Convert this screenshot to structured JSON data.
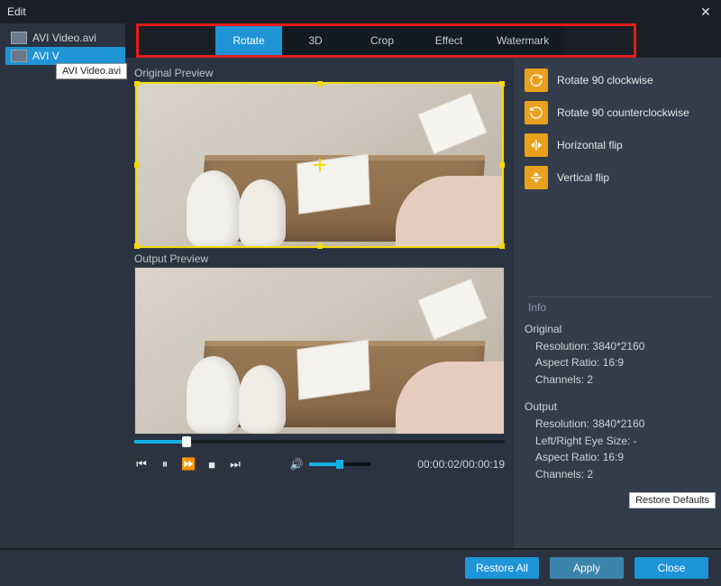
{
  "title": "Edit",
  "sidebar": {
    "items": [
      {
        "label": "AVI Video.avi"
      },
      {
        "label": "AVI V"
      }
    ],
    "tooltip": "AVI Video.avi"
  },
  "tabs": [
    {
      "label": "Rotate",
      "active": true
    },
    {
      "label": "3D"
    },
    {
      "label": "Crop"
    },
    {
      "label": "Effect"
    },
    {
      "label": "Watermark"
    }
  ],
  "previews": {
    "original_label": "Original Preview",
    "output_label": "Output Preview"
  },
  "playback": {
    "time": "00:00:02/00:00:19"
  },
  "rotate_options": [
    {
      "label": "Rotate 90 clockwise",
      "icon": "rotate-cw"
    },
    {
      "label": "Rotate 90 counterclockwise",
      "icon": "rotate-ccw"
    },
    {
      "label": "Horizontal flip",
      "icon": "flip-h"
    },
    {
      "label": "Vertical flip",
      "icon": "flip-v"
    }
  ],
  "info": {
    "header": "Info",
    "original_label": "Original",
    "original": {
      "resolution_label": "Resolution:",
      "resolution": "3840*2160",
      "aspect_label": "Aspect Ratio:",
      "aspect": "16:9",
      "channels_label": "Channels:",
      "channels": "2"
    },
    "output_label": "Output",
    "output": {
      "resolution_label": "Resolution:",
      "resolution": "3840*2160",
      "eyesize_label": "Left/Right Eye Size:",
      "eyesize": "-",
      "aspect_label": "Aspect Ratio:",
      "aspect": "16:9",
      "channels_label": "Channels:",
      "channels": "2"
    }
  },
  "buttons": {
    "restore_defaults": "Restore Defaults",
    "restore_all": "Restore All",
    "apply": "Apply",
    "close": "Close"
  }
}
